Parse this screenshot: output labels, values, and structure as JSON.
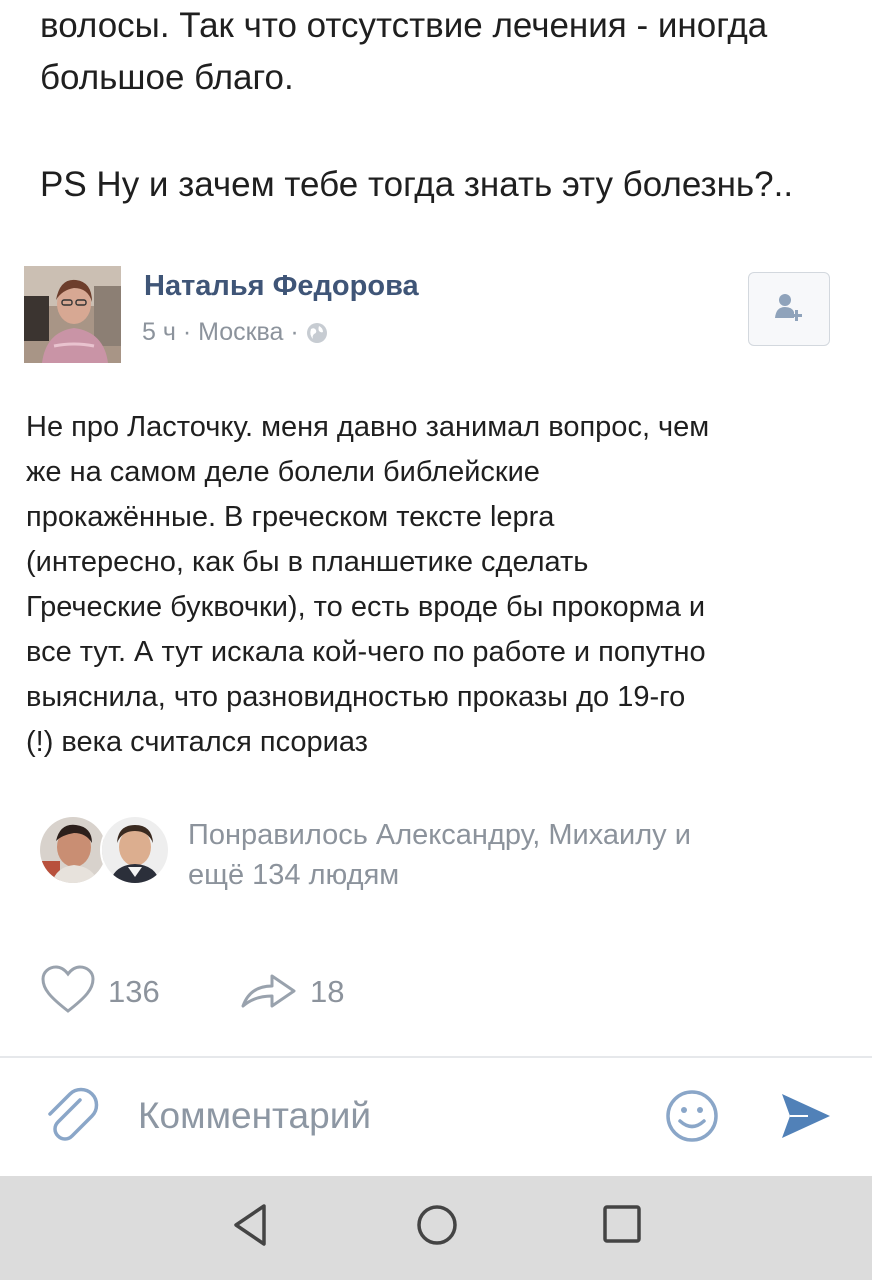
{
  "previous_comment": {
    "lines": [
      "волосы. Так что отсутствие лечения - иногда",
      "большое благо.",
      "PS Ну и зачем тебе тогда знать эту болезнь?.."
    ]
  },
  "post": {
    "author": "Наталья Федорова",
    "meta": "5 ч · Москва ·",
    "text_lines": [
      "Не про Ласточку. меня давно занимал вопрос, чем",
      "же на самом деле болели библейские",
      "прокажённые. В греческом тексте lepra",
      "(интересно, как бы в планшетике сделать",
      "Греческие буквочки), то есть вроде бы прокорма и",
      "все тут. А тут искала кой-чего по работе и попутно",
      "выяснила, что разновидностью проказы до 19-го",
      "(!) века считался псориаз"
    ]
  },
  "likes": {
    "text_lines": [
      "Понравилось Александру, Михаилу и",
      "ещё 134 людям"
    ]
  },
  "actions": {
    "like_count": "136",
    "share_count": "18"
  },
  "comment_bar": {
    "placeholder": "Комментарий"
  },
  "colors": {
    "accent": "#5181b8",
    "author_name": "#3f5577",
    "muted_text": "#8c939c",
    "navbar_bg": "#dcdcdc"
  },
  "icons": {
    "add_friend": "add-friend-icon",
    "globe": "globe-icon",
    "like": "heart-icon",
    "share": "share-arrow-icon",
    "attach": "paperclip-icon",
    "emoji": "smiley-icon",
    "send": "send-icon",
    "back": "triangle-back-icon",
    "home": "circle-home-icon",
    "recent": "square-recent-icon"
  }
}
